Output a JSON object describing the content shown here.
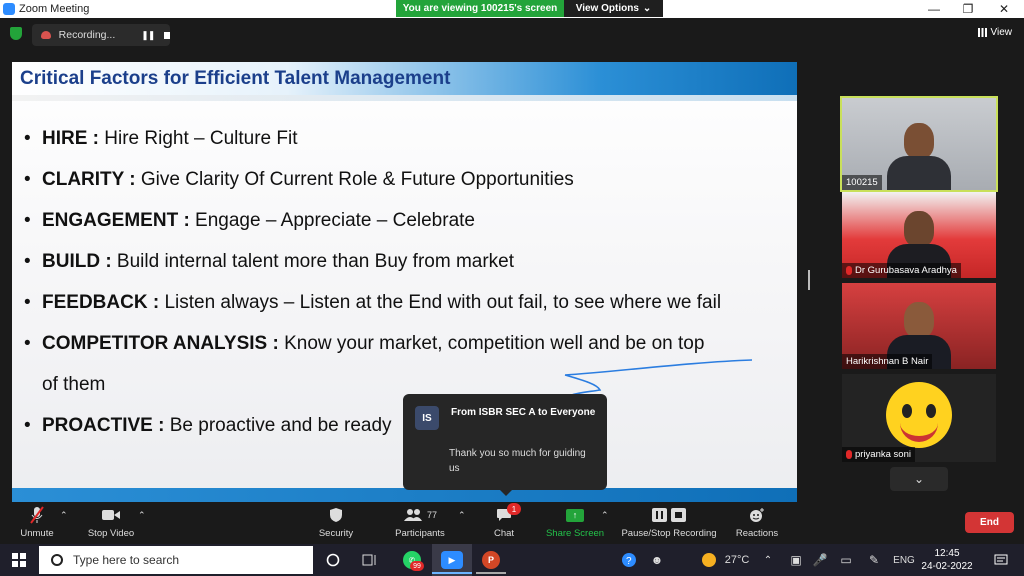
{
  "window": {
    "title": "Zoom Meeting",
    "viewing_banner": "You are viewing 100215's screen",
    "view_options": "View Options",
    "min_icon": "minimize-icon",
    "max_icon": "restore-icon",
    "close_icon": "close-icon"
  },
  "topbar": {
    "recording_label": "Recording...",
    "view_label": "View"
  },
  "slide": {
    "title": "Critical Factors for Efficient Talent Management",
    "bullets": [
      {
        "key": "HIRE :",
        "text": " Hire Right – Culture Fit"
      },
      {
        "key": "CLARITY :",
        "text": " Give Clarity Of Current Role & Future Opportunities"
      },
      {
        "key": "ENGAGEMENT :",
        "text": " Engage – Appreciate – Celebrate"
      },
      {
        "key": "BUILD :",
        "text": " Build internal talent more than Buy from market"
      },
      {
        "key": "FEEDBACK :",
        "text": " Listen always – Listen at the End with out fail, to see where we fail"
      },
      {
        "key": "COMPETITOR ANALYSIS :",
        "text": " Know your market, competition well and be on top",
        "text2": "of them"
      },
      {
        "key": "PROACTIVE :",
        "text": " Be proactive and be ready"
      }
    ]
  },
  "chat_toast": {
    "avatar_initials": "IS",
    "from": "From ISBR SEC A to Everyone",
    "message": "Thank you so much for guiding us"
  },
  "participants": [
    {
      "name": "100215",
      "muted": false
    },
    {
      "name": "Dr Gurubasava Aradhya",
      "muted": true
    },
    {
      "name": "Harikrishnan B Nair",
      "muted": false
    },
    {
      "name": "priyanka soni",
      "muted": true
    }
  ],
  "toolbar": {
    "unmute": "Unmute",
    "stop_video": "Stop Video",
    "security": "Security",
    "participants": "Participants",
    "participants_count": "77",
    "chat": "Chat",
    "chat_badge": "1",
    "share_screen": "Share Screen",
    "pause_stop_recording": "Pause/Stop Recording",
    "reactions": "Reactions",
    "end": "End"
  },
  "taskbar": {
    "search_placeholder": "Type here to search",
    "whatsapp_badge": "99",
    "ppt_letter": "P",
    "temperature": "27°C",
    "language": "ENG",
    "time": "12:45",
    "date": "24-02-2022"
  },
  "colors": {
    "share_green": "#23a43a",
    "end_red": "#d33535",
    "title_blue": "#1b3f8b",
    "active_speaker": "#c9e05a"
  }
}
